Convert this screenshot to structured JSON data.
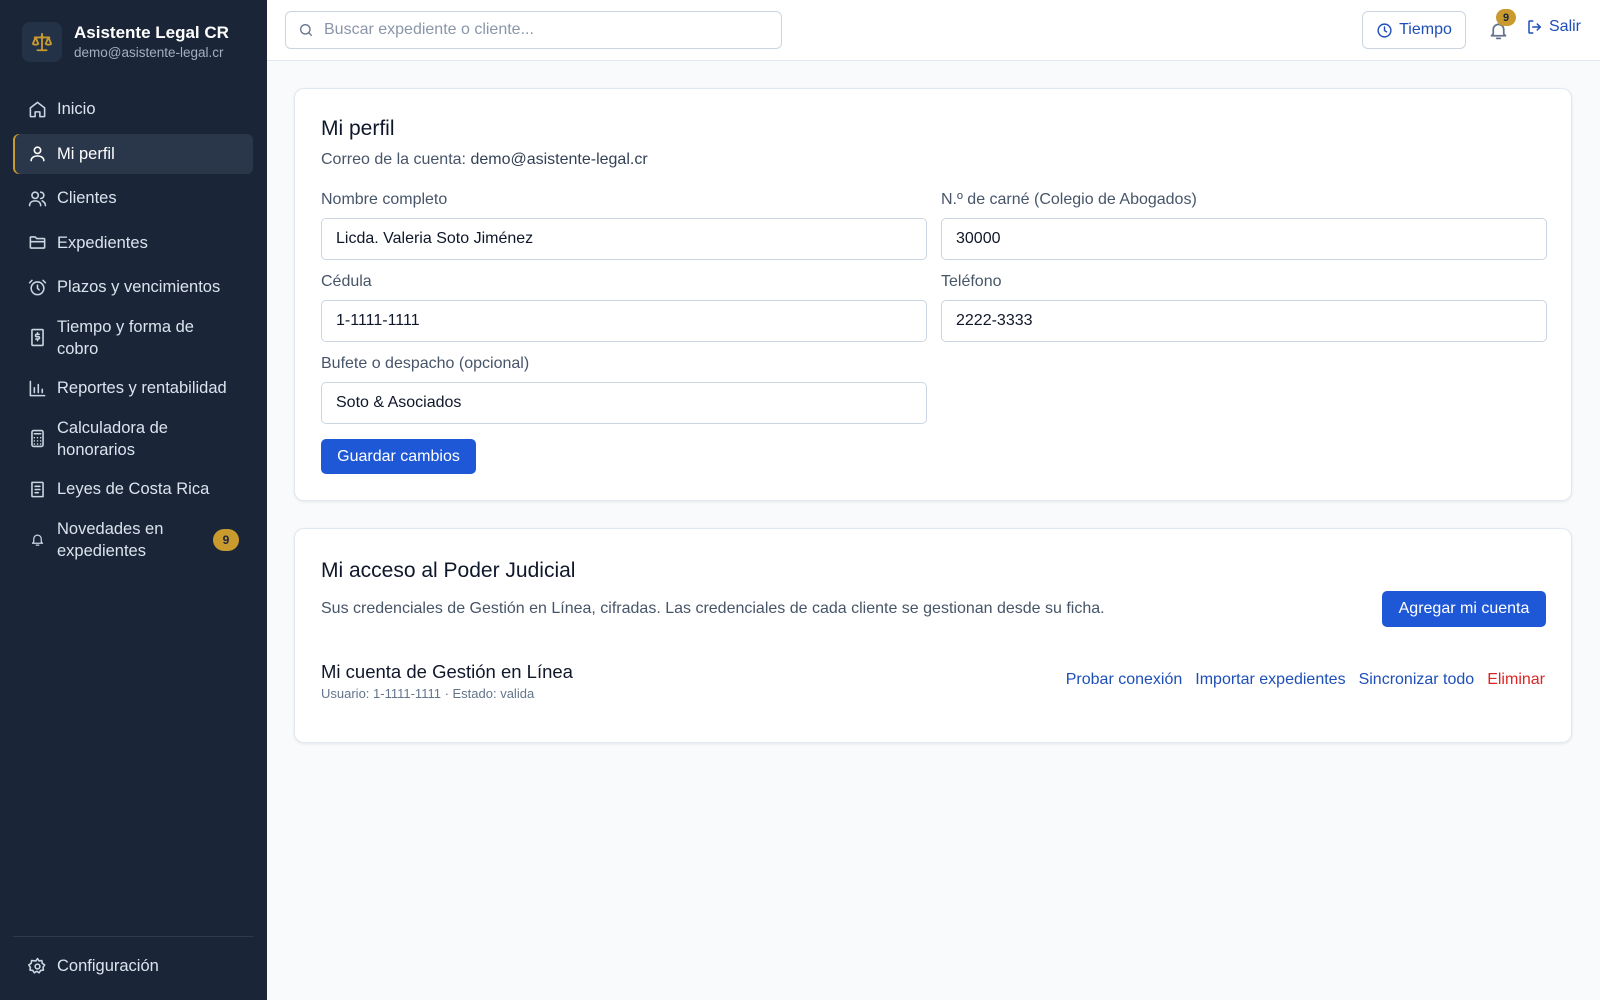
{
  "brand": {
    "title": "Asistente Legal CR",
    "email": "demo@asistente-legal.cr"
  },
  "sidebar": {
    "items": [
      {
        "label": "Inicio",
        "icon": "home-icon"
      },
      {
        "label": "Mi perfil",
        "icon": "user-icon",
        "active": true
      },
      {
        "label": "Clientes",
        "icon": "users-icon"
      },
      {
        "label": "Expedientes",
        "icon": "folder-icon"
      },
      {
        "label": "Plazos y vencimientos",
        "icon": "alarm-clock-icon"
      },
      {
        "label": "Tiempo y forma de cobro",
        "icon": "receipt-icon"
      },
      {
        "label": "Reportes y rentabilidad",
        "icon": "bar-chart-icon"
      },
      {
        "label": "Calculadora de honorarios",
        "icon": "calculator-icon"
      },
      {
        "label": "Leyes de Costa Rica",
        "icon": "book-icon"
      },
      {
        "label": "Novedades en expedientes",
        "icon": "bell-icon",
        "badge": "9"
      }
    ],
    "settings_label": "Configuración"
  },
  "topbar": {
    "search_placeholder": "Buscar expediente o cliente...",
    "time_button": "Tiempo",
    "notifications_count": "9",
    "logout": "Salir"
  },
  "profile": {
    "title": "Mi perfil",
    "account_prefix": "Correo de la cuenta:",
    "account_email": "demo@asistente-legal.cr",
    "fields": {
      "full_name": {
        "label": "Nombre completo",
        "value": "Licda. Valeria Soto Jiménez"
      },
      "bar_number": {
        "label": "N.º de carné (Colegio de Abogados)",
        "value": "30000"
      },
      "id_number": {
        "label": "Cédula",
        "value": "1-1111-1111"
      },
      "phone": {
        "label": "Teléfono",
        "value": "2222-3333"
      },
      "firm": {
        "label": "Bufete o despacho (opcional)",
        "value": "Soto & Asociados"
      }
    },
    "save_button": "Guardar cambios"
  },
  "judicial": {
    "title": "Mi acceso al Poder Judicial",
    "description": "Sus credenciales de Gestión en Línea, cifradas. Las credenciales de cada cliente se gestionan desde su ficha.",
    "add_button": "Agregar mi cuenta",
    "account": {
      "title": "Mi cuenta de Gestión en Línea",
      "meta": "Usuario: 1-1111-1111 · Estado: valida",
      "actions": {
        "test": "Probar conexión",
        "import": "Importar expedientes",
        "sync": "Sincronizar todo",
        "delete": "Eliminar"
      }
    }
  },
  "colors": {
    "sidebar_bg": "#1a2537",
    "accent_gold": "#c99a2e",
    "primary_blue": "#1f58d6",
    "danger_red": "#dc2626"
  }
}
